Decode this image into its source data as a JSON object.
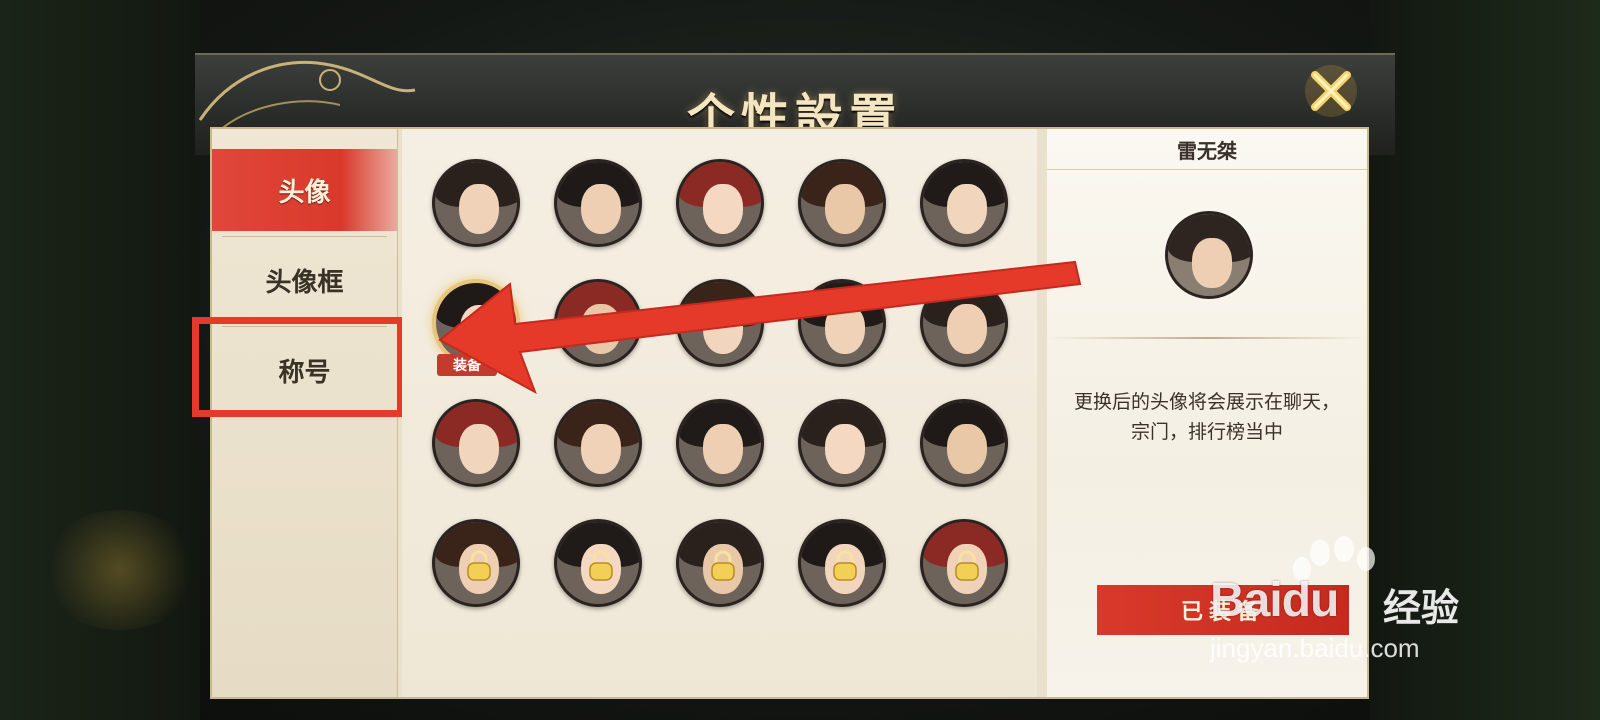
{
  "dialog": {
    "title": "个性設置",
    "close_icon": "close-x-icon"
  },
  "tabs": [
    {
      "label": "头像",
      "active": true
    },
    {
      "label": "头像框",
      "active": false
    },
    {
      "label": "称号",
      "active": false,
      "highlighted": true
    }
  ],
  "avatars": {
    "rows": [
      [
        {
          "locked": false
        },
        {
          "locked": false
        },
        {
          "locked": false
        },
        {
          "locked": false
        },
        {
          "locked": false
        }
      ],
      [
        {
          "locked": false,
          "equipped": true,
          "tag": "装备"
        },
        {
          "locked": false
        },
        {
          "locked": false
        },
        {
          "locked": false
        },
        {
          "locked": false
        }
      ],
      [
        {
          "locked": false
        },
        {
          "locked": false
        },
        {
          "locked": false
        },
        {
          "locked": false
        },
        {
          "locked": false
        }
      ],
      [
        {
          "locked": true
        },
        {
          "locked": true
        },
        {
          "locked": true
        },
        {
          "locked": true
        },
        {
          "locked": true
        }
      ]
    ]
  },
  "detail": {
    "name": "雷无桀",
    "description": "更换后的头像将会展示在聊天，宗门，排行榜当中",
    "button_label": "已装备"
  },
  "watermark": {
    "brand": "Baidu",
    "cn": "经验",
    "url": "jingyan.baidu.com"
  },
  "colors": {
    "accent_red": "#d9392b",
    "panel_bg": "#efe7d6",
    "title_gold": "#f3e6c0"
  }
}
